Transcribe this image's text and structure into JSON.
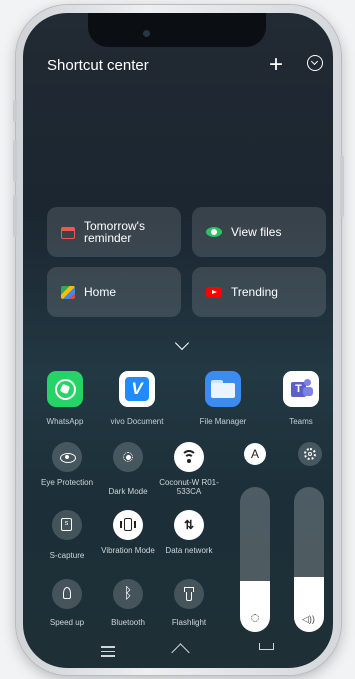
{
  "header": {
    "title": "Shortcut center"
  },
  "cards": [
    {
      "label": "Tomorrow's reminder",
      "icon": "calendar-icon",
      "color": "#f05a4e"
    },
    {
      "label": "View files",
      "icon": "eye-icon",
      "color": "#2ec067"
    },
    {
      "label": "Home",
      "icon": "maps-icon",
      "color": "#4285f4"
    },
    {
      "label": "Trending",
      "icon": "youtube-icon",
      "color": "#ff0000"
    }
  ],
  "apps": [
    {
      "label": "WhatsApp",
      "icon": "whatsapp-icon",
      "color": "#25d366"
    },
    {
      "label": "vivo Document",
      "icon": "vivo-document-icon",
      "color": "#1f8bff"
    },
    {
      "label": "File Manager",
      "icon": "folder-icon",
      "color": "#3b8cf0"
    },
    {
      "label": "Teams",
      "icon": "teams-icon",
      "color": "#5b5fc7"
    }
  ],
  "toggles": [
    {
      "label": "Eye Protection",
      "icon": "eye-icon",
      "on": false
    },
    {
      "label": "Dark Mode",
      "icon": "dark-mode-icon",
      "on": false
    },
    {
      "label": "Coconut-W R01-533CA",
      "icon": "wifi-icon",
      "on": true
    },
    {
      "label": "S-capture",
      "icon": "screenshot-icon",
      "on": false
    },
    {
      "label": "Vibration Mode",
      "icon": "vibration-icon",
      "on": true
    },
    {
      "label": "Data network",
      "icon": "data-network-icon",
      "on": true
    },
    {
      "label": "Speed up",
      "icon": "rocket-icon",
      "on": false
    },
    {
      "label": "Bluetooth",
      "icon": "bluetooth-icon",
      "on": false
    },
    {
      "label": "Flashlight",
      "icon": "flashlight-icon",
      "on": false
    }
  ],
  "auto_brightness": {
    "label": "A"
  },
  "sliders": {
    "brightness": {
      "level": 0.35,
      "icon": "brightness-icon"
    },
    "volume": {
      "level": 0.38,
      "icon": "volume-icon"
    }
  },
  "navbar": [
    "menu-icon",
    "home-icon",
    "back-icon"
  ]
}
